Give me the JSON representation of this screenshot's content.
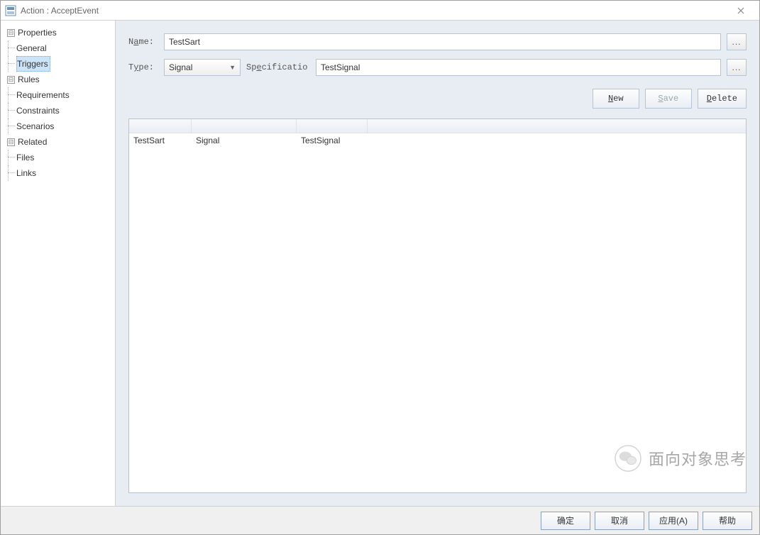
{
  "window": {
    "title": "Action : AcceptEvent"
  },
  "sidebar": {
    "properties_label": "Properties",
    "general_label": "General",
    "triggers_label": "Triggers",
    "rules_label": "Rules",
    "requirements_label": "Requirements",
    "constraints_label": "Constraints",
    "scenarios_label": "Scenarios",
    "related_label": "Related",
    "files_label": "Files",
    "links_label": "Links",
    "selected": "Triggers"
  },
  "form": {
    "name_label_html": [
      "N",
      "a",
      "m",
      "e",
      ":"
    ],
    "name_underline_index": 1,
    "name_label": "Name:",
    "name_value": "TestSart",
    "type_label_html": [
      "T",
      "y",
      "p",
      "e",
      ":"
    ],
    "type_underline_index": 1,
    "type_label": "Type:",
    "type_value": "Signal",
    "spec_label_html": [
      "S",
      "p",
      "e",
      "c",
      "i",
      "f",
      "i",
      "c",
      "a",
      "t",
      "i",
      "o"
    ],
    "spec_underline_index": 2,
    "spec_label": "Specificatio",
    "spec_value": "TestSignal",
    "ellipsis": "..."
  },
  "actions": {
    "new_label_html": [
      "N",
      "e",
      "w"
    ],
    "new_underline_index": 0,
    "new_label": "New",
    "save_label_html": [
      "S",
      "a",
      "v",
      "e"
    ],
    "save_underline_index": 0,
    "save_label": "Save",
    "delete_label_html": [
      "D",
      "e",
      "l",
      "e",
      "t",
      "e"
    ],
    "delete_underline_index": 0,
    "delete_label": "Delete"
  },
  "grid": {
    "rows": [
      {
        "c1": "TestSart",
        "c2": "Signal",
        "c3": "TestSignal"
      }
    ]
  },
  "footer": {
    "ok": "确定",
    "cancel": "取消",
    "apply": "应用(A)",
    "help": "帮助"
  },
  "watermark": {
    "text": "面向对象思考"
  }
}
